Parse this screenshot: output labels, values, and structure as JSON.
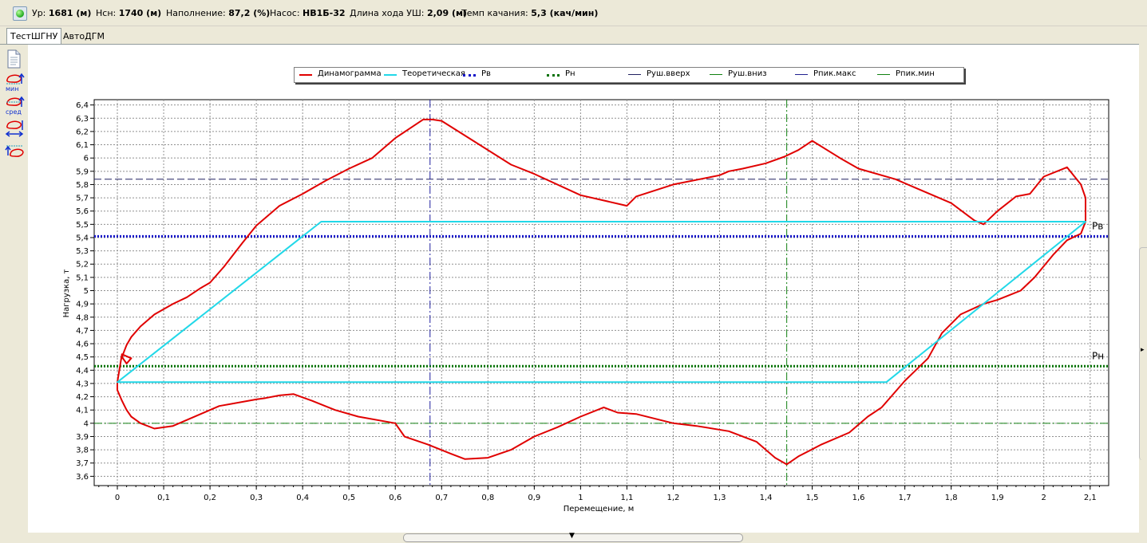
{
  "status": {
    "ur_label": "Ур:",
    "ur_value": "1681 (м)",
    "hsn_label": "Нсн:",
    "hsn_value": "1740 (м)",
    "fill_label": "Наполнение:",
    "fill_value": "87,2 (%)",
    "pump_label": "Насос:",
    "pump_value": "НВ1Б-32",
    "stroke_label": "Длина хода УШ:",
    "stroke_value": "2,09 (м)",
    "rate_label": "Темп качания:",
    "rate_value": "5,3 (кач/мин)"
  },
  "tabs": [
    {
      "label": "ТестШГНУ",
      "active": true
    },
    {
      "label": "АвтоДГМ",
      "active": false
    }
  ],
  "tools": [
    "document-icon",
    "min-loop-icon",
    "avg-loop-icon",
    "resize-loop-icon",
    "top-loop-icon"
  ],
  "tool_labels": {
    "min": "мин",
    "avg": "сред"
  },
  "legend": [
    {
      "label": "Динамограмма",
      "color": "#e00000",
      "style": "solid"
    },
    {
      "label": "Теоретическая",
      "color": "#22d8e8",
      "style": "solid"
    },
    {
      "label": "Рв",
      "color": "#1010c8",
      "style": "dotted"
    },
    {
      "label": "Рн",
      "color": "#007000",
      "style": "dotted"
    },
    {
      "label": "Руш.вверх",
      "color": "#202060",
      "style": "dash"
    },
    {
      "label": "Руш.вниз",
      "color": "#108010",
      "style": "dash"
    },
    {
      "label": "Рпик.макс",
      "color": "#202090",
      "style": "dashdot"
    },
    {
      "label": "Рпик.мин",
      "color": "#108010",
      "style": "dashdot"
    }
  ],
  "chart_data": {
    "type": "line",
    "xlabel": "Перемещение, м",
    "ylabel": "Нагрузка, т",
    "xlim": [
      -0.05,
      2.14
    ],
    "ylim": [
      3.53,
      6.44
    ],
    "xticks": [
      0,
      0.1,
      0.2,
      0.3,
      0.4,
      0.5,
      0.6,
      0.7,
      0.8,
      0.9,
      1,
      1.1,
      1.2,
      1.3,
      1.4,
      1.5,
      1.6,
      1.7,
      1.8,
      1.9,
      2,
      2.1
    ],
    "xticklabels": [
      "0",
      "0,1",
      "0,2",
      "0,3",
      "0,4",
      "0,5",
      "0,6",
      "0,7",
      "0,8",
      "0,9",
      "1",
      "1,1",
      "1,2",
      "1,3",
      "1,4",
      "1,5",
      "1,6",
      "1,7",
      "1,8",
      "1,9",
      "2",
      "2,1"
    ],
    "yticks": [
      3.6,
      3.7,
      3.8,
      3.9,
      4,
      4.1,
      4.2,
      4.3,
      4.4,
      4.5,
      4.6,
      4.7,
      4.8,
      4.9,
      5,
      5.1,
      5.2,
      5.3,
      5.4,
      5.5,
      5.6,
      5.7,
      5.8,
      5.9,
      6,
      6.1,
      6.2,
      6.3,
      6.4
    ],
    "yticklabels": [
      "3,6",
      "3,7",
      "3,8",
      "3,9",
      "4",
      "4,1",
      "4,2",
      "4,3",
      "4,4",
      "4,5",
      "4,6",
      "4,7",
      "4,8",
      "4,9",
      "5",
      "5,1",
      "5,2",
      "5,3",
      "5,4",
      "5,5",
      "5,6",
      "5,7",
      "5,8",
      "5,9",
      "6",
      "6,1",
      "6,2",
      "6,3",
      "6,4"
    ],
    "grid": true,
    "series": [
      {
        "name": "Динамограмма",
        "color": "#e00000",
        "closed": true,
        "x": [
          0,
          0,
          0.01,
          0.02,
          0.03,
          0.05,
          0.08,
          0.12,
          0.18,
          0.22,
          0.3,
          0.32,
          0.35,
          0.38,
          0.42,
          0.47,
          0.52,
          0.6,
          0.62,
          0.67,
          0.72,
          0.75,
          0.8,
          0.85,
          0.9,
          0.95,
          1,
          1.05,
          1.08,
          1.12,
          1.2,
          1.25,
          1.32,
          1.38,
          1.42,
          1.445,
          1.47,
          1.52,
          1.58,
          1.62,
          1.65,
          1.67,
          1.7,
          1.75,
          1.78,
          1.82,
          1.87,
          1.9,
          1.95,
          1.98,
          2.02,
          2.05,
          2.08,
          2.09,
          2.09,
          2.08,
          2.05,
          2.0,
          1.97,
          1.94,
          1.9,
          1.87,
          1.85,
          1.8,
          1.72,
          1.68,
          1.6,
          1.56,
          1.5,
          1.47,
          1.44,
          1.4,
          1.35,
          1.32,
          1.3,
          1.2,
          1.12,
          1.1,
          1.0,
          0.9,
          0.85,
          0.75,
          0.7,
          0.68,
          0.66,
          0.6,
          0.55,
          0.5,
          0.45,
          0.4,
          0.35,
          0.3,
          0.27,
          0.23,
          0.2,
          0.18,
          0.15,
          0.12,
          0.08,
          0.05,
          0.03,
          0.02,
          0.01,
          0.02,
          0.03,
          0.01,
          0
        ],
        "y": [
          4.31,
          4.25,
          4.17,
          4.1,
          4.05,
          4.0,
          3.96,
          3.98,
          4.07,
          4.13,
          4.18,
          4.19,
          4.21,
          4.22,
          4.17,
          4.1,
          4.05,
          4.0,
          3.9,
          3.84,
          3.77,
          3.73,
          3.74,
          3.8,
          3.9,
          3.97,
          4.05,
          4.12,
          4.08,
          4.07,
          4.0,
          3.98,
          3.94,
          3.86,
          3.74,
          3.69,
          3.75,
          3.84,
          3.93,
          4.05,
          4.12,
          4.2,
          4.32,
          4.49,
          4.68,
          4.82,
          4.9,
          4.93,
          5.0,
          5.1,
          5.27,
          5.38,
          5.43,
          5.52,
          5.7,
          5.8,
          5.93,
          5.86,
          5.73,
          5.71,
          5.6,
          5.5,
          5.53,
          5.66,
          5.78,
          5.84,
          5.92,
          6.0,
          6.13,
          6.06,
          6.01,
          5.96,
          5.92,
          5.9,
          5.87,
          5.8,
          5.71,
          5.64,
          5.72,
          5.88,
          5.95,
          6.17,
          6.28,
          6.29,
          6.29,
          6.15,
          6.0,
          5.92,
          5.83,
          5.73,
          5.64,
          5.49,
          5.36,
          5.18,
          5.06,
          5.02,
          4.95,
          4.9,
          4.82,
          4.73,
          4.65,
          4.59,
          4.5,
          4.45,
          4.49,
          4.52,
          4.31
        ]
      },
      {
        "name": "Теоретическая",
        "color": "#22d8e8",
        "closed": true,
        "x": [
          0,
          0.44,
          2.09,
          1.66,
          0
        ],
        "y": [
          4.31,
          5.52,
          5.52,
          4.31,
          4.31
        ]
      }
    ],
    "hlines": [
      {
        "name": "Рв",
        "y": 5.41,
        "color": "#1010c8",
        "style": "dotted",
        "label": "Рв"
      },
      {
        "name": "Рн",
        "y": 4.43,
        "color": "#007000",
        "style": "dotted",
        "label": "Рн"
      },
      {
        "name": "Рпик.макс",
        "y": 5.84,
        "color": "#202060",
        "style": "dashed"
      },
      {
        "name": "Рпик.мин",
        "y": 4.0,
        "color": "#108010",
        "style": "dashdot"
      }
    ],
    "vlines": [
      {
        "name": "Руш.вверх",
        "x": 0.675,
        "color": "#2020a0",
        "style": "dashdot"
      },
      {
        "name": "Руш.вниз",
        "x": 1.445,
        "color": "#108010",
        "style": "dashdot"
      }
    ]
  }
}
